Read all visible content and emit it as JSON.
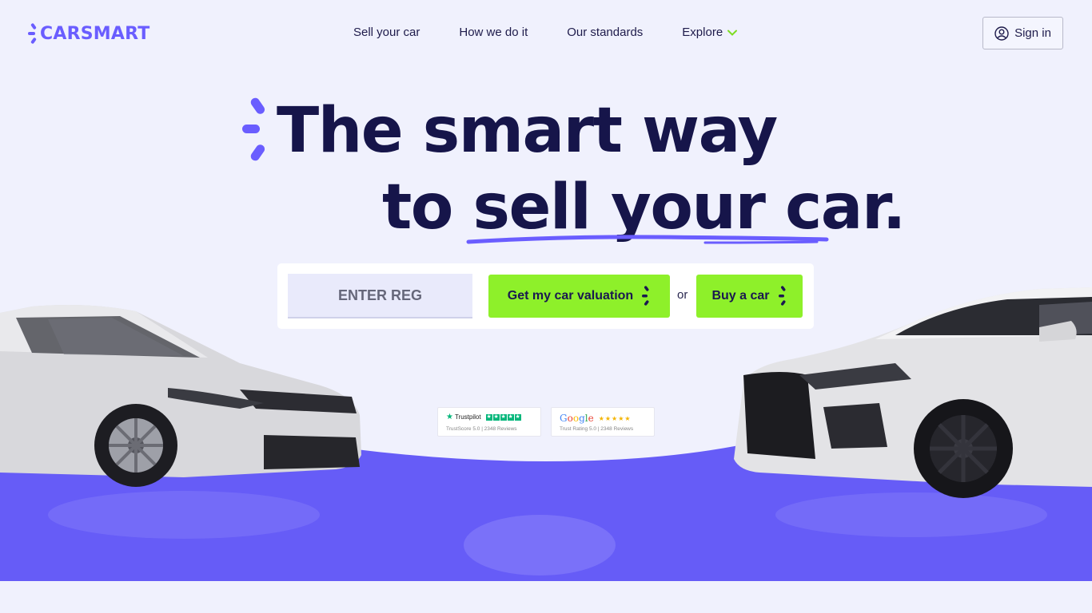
{
  "brand": {
    "name": "CARSMART",
    "color": "#6a5dff"
  },
  "nav": {
    "items": [
      {
        "label": "Sell your car"
      },
      {
        "label": "How we do it"
      },
      {
        "label": "Our standards"
      },
      {
        "label": "Explore"
      }
    ],
    "explore_icon": "chevron-down-icon",
    "signin_label": "Sign in",
    "signin_icon": "user-circle-icon"
  },
  "hero": {
    "line1": "The smart way",
    "line2": "to sell your car."
  },
  "form": {
    "reg_placeholder": "ENTER REG",
    "valuation_label": "Get my car valuation",
    "or_label": "or",
    "buy_label": "Buy a car"
  },
  "badges": {
    "trustpilot": {
      "name": "Trustpilot",
      "detail": "TrustScore 5.0 | 2348 Reviews"
    },
    "google": {
      "name": "Google",
      "stars": "★★★★★",
      "detail": "Trust Rating 5.0 | 2348 Reviews"
    }
  },
  "colors": {
    "accent": "#6a5dff",
    "cta_green": "#8ef02a",
    "heading": "#16154a",
    "floor": "#665cf7",
    "background": "#f0f1fd"
  }
}
